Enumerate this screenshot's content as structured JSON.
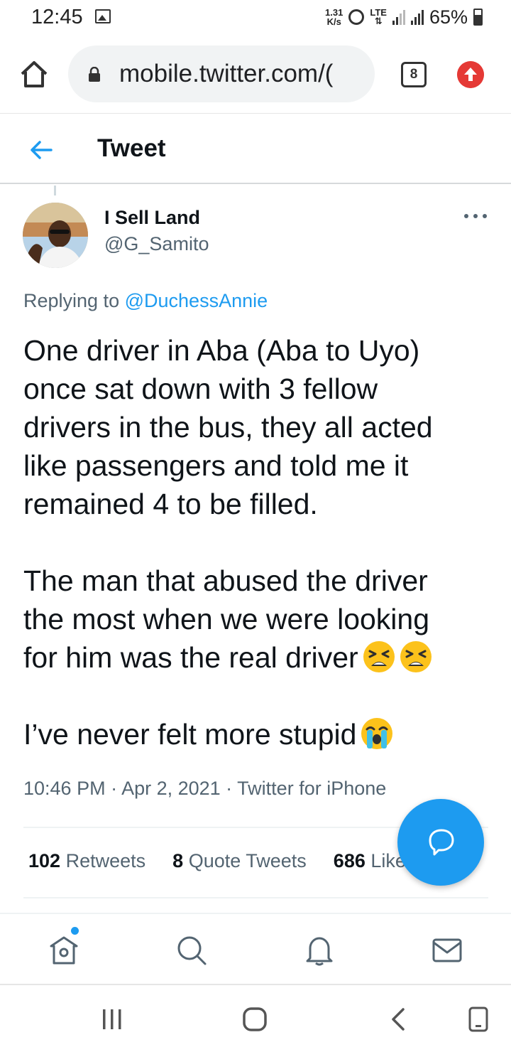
{
  "status_bar": {
    "time": "12:45",
    "net_speed_value": "1.31",
    "net_speed_unit": "K/s",
    "network": "LTE",
    "battery": "65%"
  },
  "browser": {
    "url": "mobile.twitter.com/(",
    "tab_count": "8"
  },
  "header": {
    "title": "Tweet"
  },
  "tweet": {
    "author_name": "I Sell Land",
    "author_handle": "@G_Samito",
    "replying_prefix": "Replying to",
    "replying_to": "@DuchessAnnie",
    "lines": [
      "One driver in Aba (Aba to Uyo)",
      "once sat down with 3 fellow",
      "drivers in the bus, they all acted",
      "like passengers and told me it",
      "remained 4 to be filled.",
      "The man that abused the driver",
      "the most when we were looking",
      "for him was the real driver",
      "I’ve never felt more stupid"
    ],
    "emojis": [
      "tired-face",
      "tired-face",
      "loudly-crying-face"
    ],
    "meta": "10:46 PM · Apr 2, 2021 · Twitter for iPhone",
    "stats": {
      "retweets_count": "102",
      "retweets_label": "Retweets",
      "quotes_count": "8",
      "quotes_label": "Quote Tweets",
      "likes_count": "686",
      "likes_label": "Likes"
    }
  },
  "bottom_nav": [
    "home-icon",
    "search-icon",
    "bell-icon",
    "mail-icon"
  ],
  "android_nav": [
    "recents-icon",
    "home-icon",
    "back-icon",
    "rotate-icon"
  ],
  "colors": {
    "accent": "#1d9bf0",
    "text_primary": "#0f1419",
    "text_secondary": "#536471",
    "update_badge": "#e53935"
  }
}
